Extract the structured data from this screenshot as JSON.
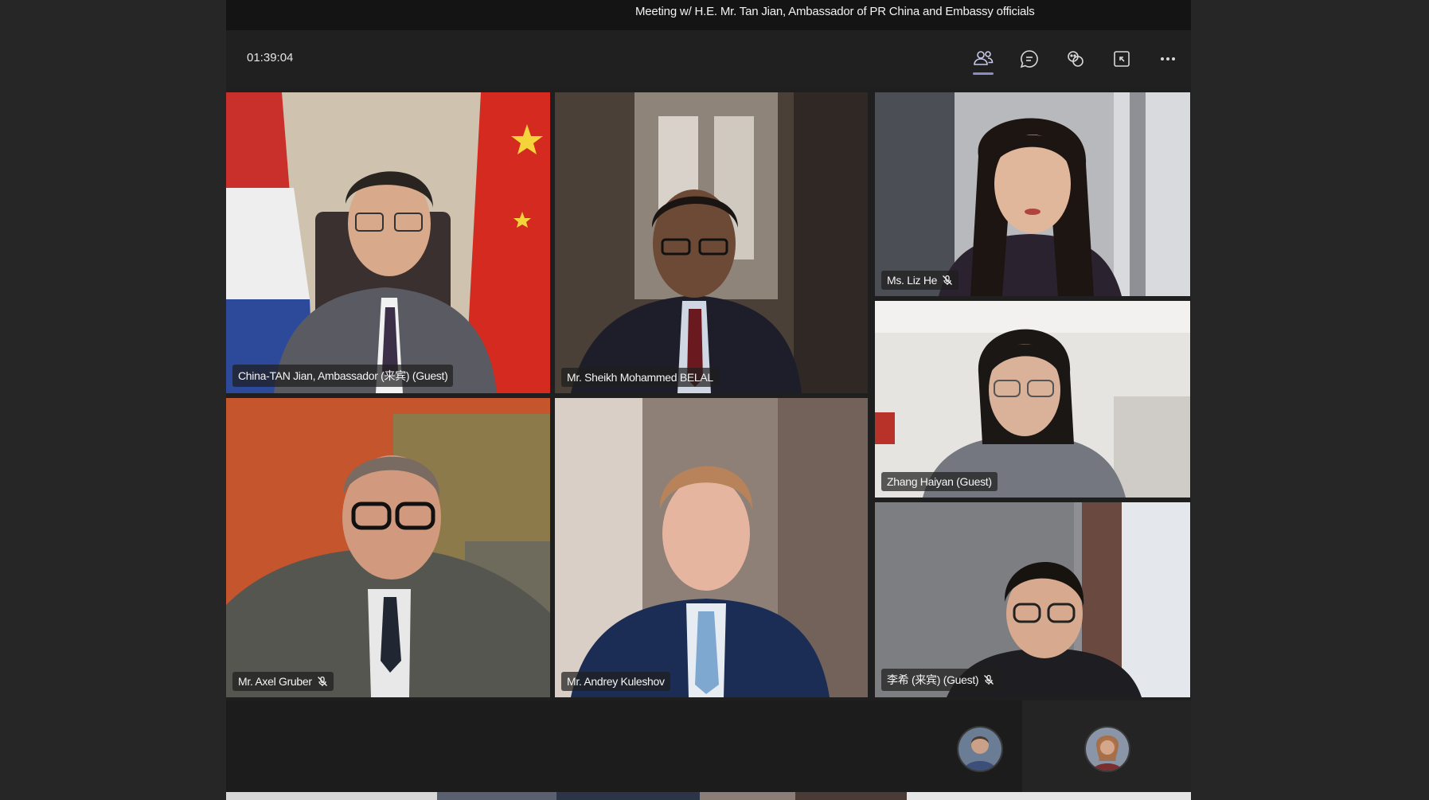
{
  "window": {
    "title": "Meeting w/ H.E. Mr. Tan Jian, Ambassador of PR China and Embassy officials"
  },
  "meeting": {
    "timer": "01:39:04"
  },
  "toolbar": {
    "buttons": [
      {
        "name": "participants",
        "icon": "people-icon",
        "active": true
      },
      {
        "name": "chat",
        "icon": "chat-icon",
        "active": false
      },
      {
        "name": "reactions",
        "icon": "reactions-icon",
        "active": false
      },
      {
        "name": "share",
        "icon": "share-screen-icon",
        "active": false
      },
      {
        "name": "more",
        "icon": "more-icon",
        "active": false
      }
    ],
    "accent_color": "#8b8cc7"
  },
  "participants": [
    {
      "id": "tan-jian",
      "name": "China-TAN Jian, Ambassador (来宾) (Guest)",
      "muted": false
    },
    {
      "id": "sheikh-belal",
      "name": "Mr. Sheikh Mohammed BELAL",
      "muted": false
    },
    {
      "id": "liz-he",
      "name": "Ms. Liz He",
      "muted": true
    },
    {
      "id": "zhang-haiyan",
      "name": "Zhang Haiyan (Guest)",
      "muted": false
    },
    {
      "id": "axel-gruber",
      "name": "Mr. Axel Gruber",
      "muted": true
    },
    {
      "id": "andrey-kuleshov",
      "name": "Mr. Andrey Kuleshov",
      "muted": false
    },
    {
      "id": "li-guest",
      "name": "李希 (来宾) (Guest)",
      "muted": true
    }
  ],
  "bottom_avatars": [
    {
      "id": "avatar-1"
    },
    {
      "id": "avatar-2"
    }
  ]
}
